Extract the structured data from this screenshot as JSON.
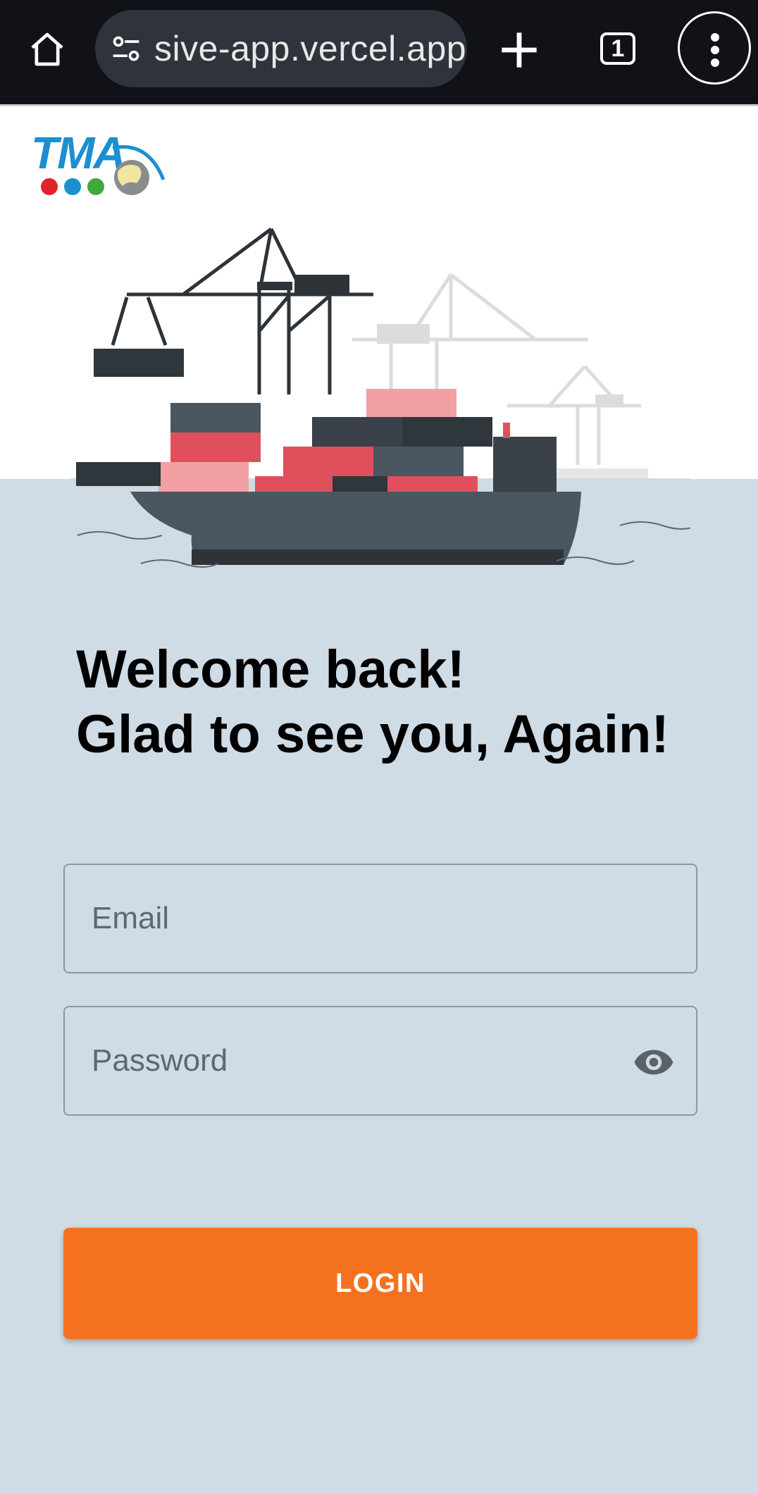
{
  "browser": {
    "url": "sive-app.vercel.app",
    "tab_count": "1"
  },
  "logo": {
    "text": "TMA"
  },
  "welcome": {
    "line1": "Welcome back!",
    "line2": "Glad to see you, Again!"
  },
  "form": {
    "email_placeholder": "Email",
    "password_placeholder": "Password",
    "login_label": "LOGIN"
  },
  "colors": {
    "chrome_bg": "#101217",
    "page_bg": "#cfdbe5",
    "accent": "#f4721f",
    "logo_blue": "#1b8fd0"
  },
  "icons": [
    "home-icon",
    "tune-icon",
    "plus-icon",
    "tab-switcher-icon",
    "more-vert-icon",
    "visibility-icon"
  ]
}
